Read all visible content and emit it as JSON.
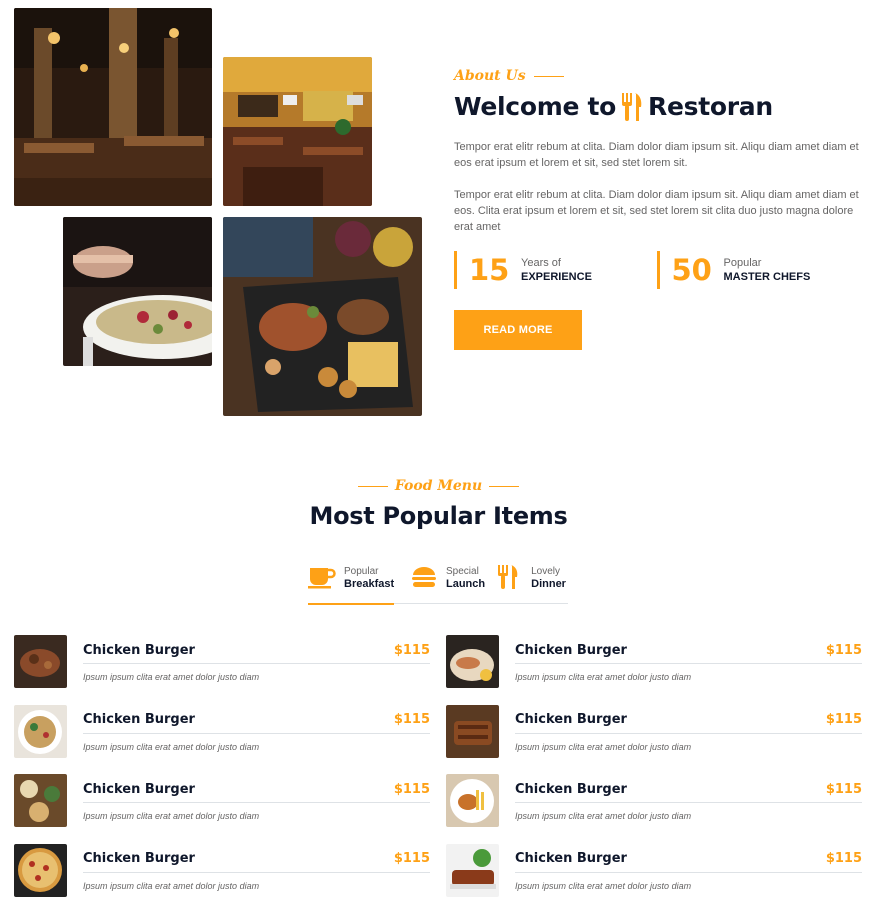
{
  "about": {
    "label": "About Us",
    "title_prefix": "Welcome to",
    "title_brand": "Restoran",
    "para1": "Tempor erat elitr rebum at clita. Diam dolor diam ipsum sit. Aliqu diam amet diam et eos erat ipsum et lorem et sit, sed stet lorem sit.",
    "para2": "Tempor erat elitr rebum at clita. Diam dolor diam ipsum sit. Aliqu diam amet diam et eos. Clita erat ipsum et lorem et sit, sed stet lorem sit clita duo justo magna dolore erat amet",
    "stats": [
      {
        "number": "15",
        "line1": "Years of",
        "line2": "EXPERIENCE"
      },
      {
        "number": "50",
        "line1": "Popular",
        "line2": "MASTER CHEFS"
      }
    ],
    "read_more": "READ MORE"
  },
  "menu": {
    "label": "Food Menu",
    "title": "Most Popular Items",
    "tabs": [
      {
        "small": "Popular",
        "big": "Breakfast",
        "icon": "coffee-icon",
        "active": true
      },
      {
        "small": "Special",
        "big": "Launch",
        "icon": "hamburger-icon",
        "active": false
      },
      {
        "small": "Lovely",
        "big": "Dinner",
        "icon": "utensils-icon",
        "active": false
      }
    ],
    "items_left": [
      {
        "name": "Chicken Burger",
        "price": "$115",
        "desc": "Ipsum ipsum clita erat amet dolor justo diam"
      },
      {
        "name": "Chicken Burger",
        "price": "$115",
        "desc": "Ipsum ipsum clita erat amet dolor justo diam"
      },
      {
        "name": "Chicken Burger",
        "price": "$115",
        "desc": "Ipsum ipsum clita erat amet dolor justo diam"
      },
      {
        "name": "Chicken Burger",
        "price": "$115",
        "desc": "Ipsum ipsum clita erat amet dolor justo diam"
      }
    ],
    "items_right": [
      {
        "name": "Chicken Burger",
        "price": "$115",
        "desc": "Ipsum ipsum clita erat amet dolor justo diam"
      },
      {
        "name": "Chicken Burger",
        "price": "$115",
        "desc": "Ipsum ipsum clita erat amet dolor justo diam"
      },
      {
        "name": "Chicken Burger",
        "price": "$115",
        "desc": "Ipsum ipsum clita erat amet dolor justo diam"
      },
      {
        "name": "Chicken Burger",
        "price": "$115",
        "desc": "Ipsum ipsum clita erat amet dolor justo diam"
      }
    ]
  },
  "colors": {
    "primary": "#FEA116",
    "dark": "#0F172B",
    "text": "#666565"
  }
}
